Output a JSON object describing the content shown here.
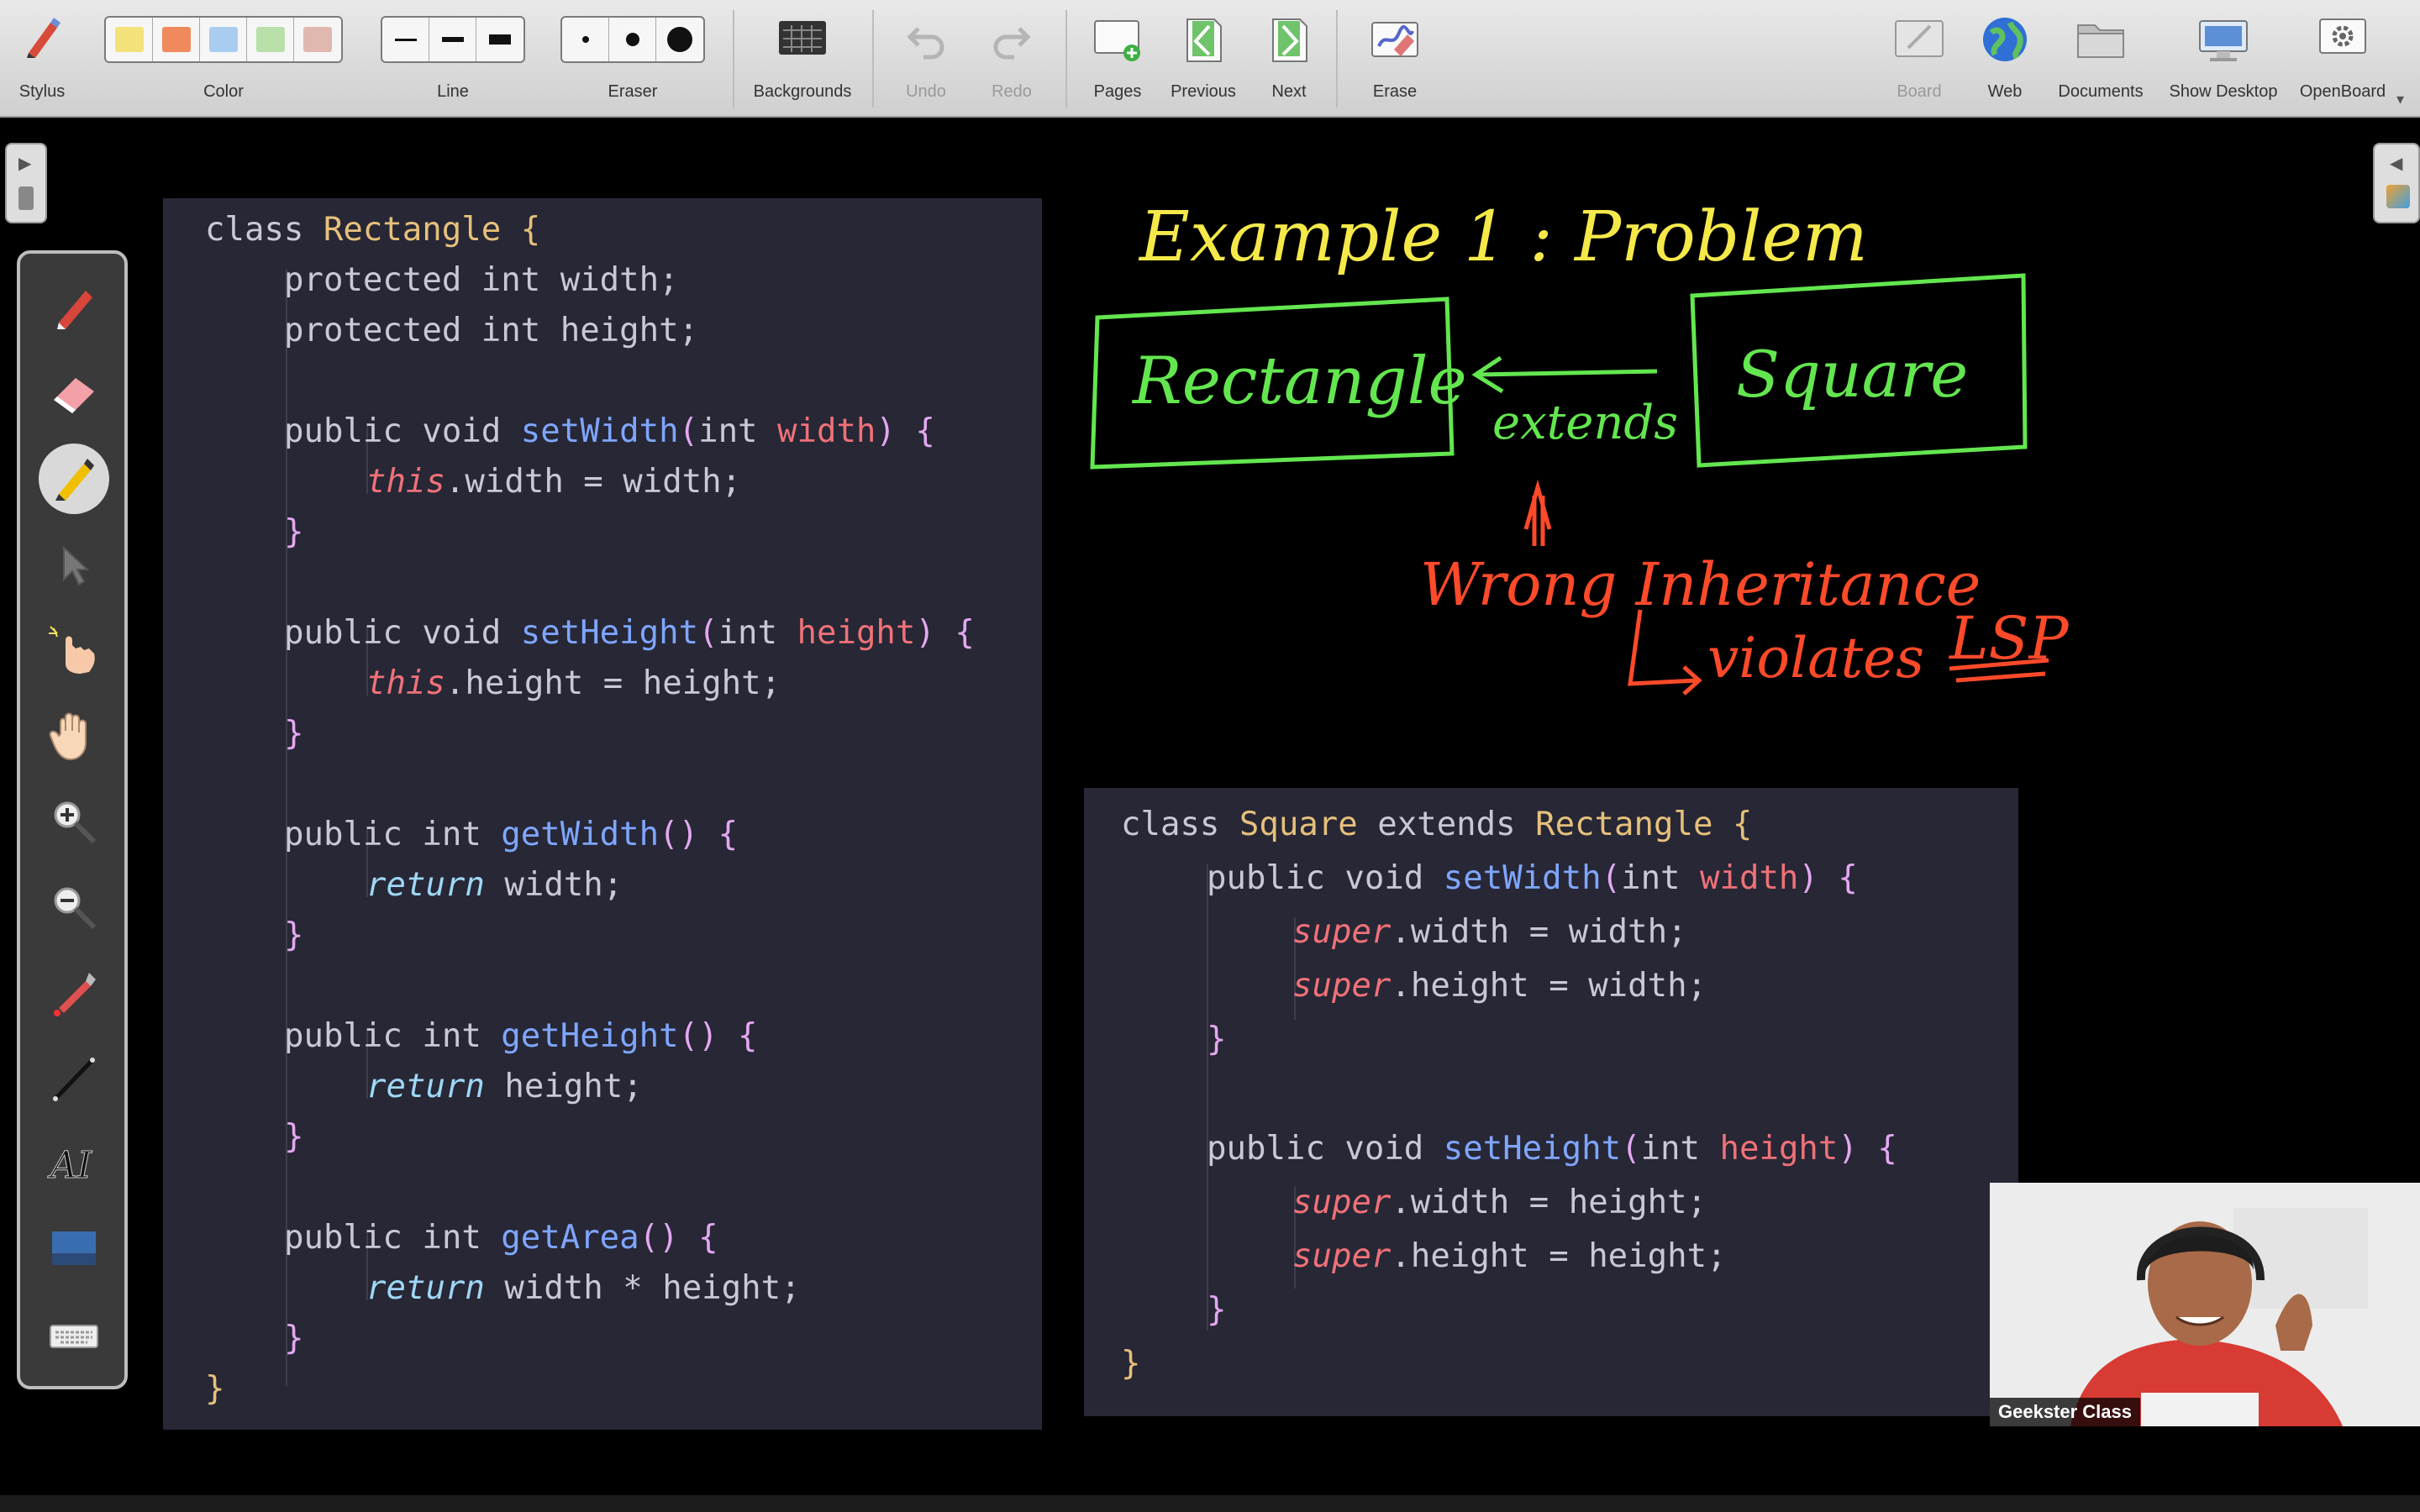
{
  "toolbar": {
    "stylus": "Stylus",
    "color": "Color",
    "line": "Line",
    "eraser": "Eraser",
    "backgrounds": "Backgrounds",
    "undo": "Undo",
    "redo": "Redo",
    "pages": "Pages",
    "previous": "Previous",
    "next": "Next",
    "erase": "Erase",
    "board": "Board",
    "web": "Web",
    "documents": "Documents",
    "show_desktop": "Show Desktop",
    "openboard": "OpenBoard",
    "swatches": [
      "#f3e27a",
      "#f08a5d",
      "#a8cdf0",
      "#b8e0a8",
      "#e0b8b0"
    ]
  },
  "palette": {
    "tools": [
      "pen-icon",
      "eraser-icon",
      "marker-icon",
      "selector-icon",
      "interactor-icon",
      "hand-icon",
      "zoom-in-icon",
      "zoom-out-icon",
      "laser-pointer-icon",
      "line-icon",
      "text-icon",
      "capture-icon",
      "keyboard-icon"
    ]
  },
  "code_left": {
    "lines": [
      "class Rectangle {",
      "protected int width;",
      "protected int height;",
      "public void setWidth(int width) {",
      "this.width = width;",
      "}",
      "public void setHeight(int height) {",
      "this.height = height;",
      "}",
      "public int getWidth() {",
      "return width;",
      "}",
      "public int getHeight() {",
      "return height;",
      "}",
      "public int getArea() {",
      "return width * height;",
      "}",
      "}"
    ]
  },
  "code_right": {
    "lines": [
      "class Square extends Rectangle {",
      "public void setWidth(int width) {",
      "super.width = width;",
      "super.height = width;",
      "}",
      "public void setHeight(int height) {",
      "super.width = height;",
      "super.height = height;",
      "}",
      "}"
    ]
  },
  "annotations": {
    "title": "Example 1 : Problem",
    "box_left": "Rectangle",
    "box_right": "Square",
    "arrow_label": "extends",
    "note": "Wrong Inheritance",
    "note2": "violates",
    "acronym": "LSP",
    "colors": {
      "yellow": "#f5e94a",
      "green": "#63e64f",
      "red": "#ff4a2a"
    }
  },
  "webcam": {
    "name": "Geekster Class"
  }
}
